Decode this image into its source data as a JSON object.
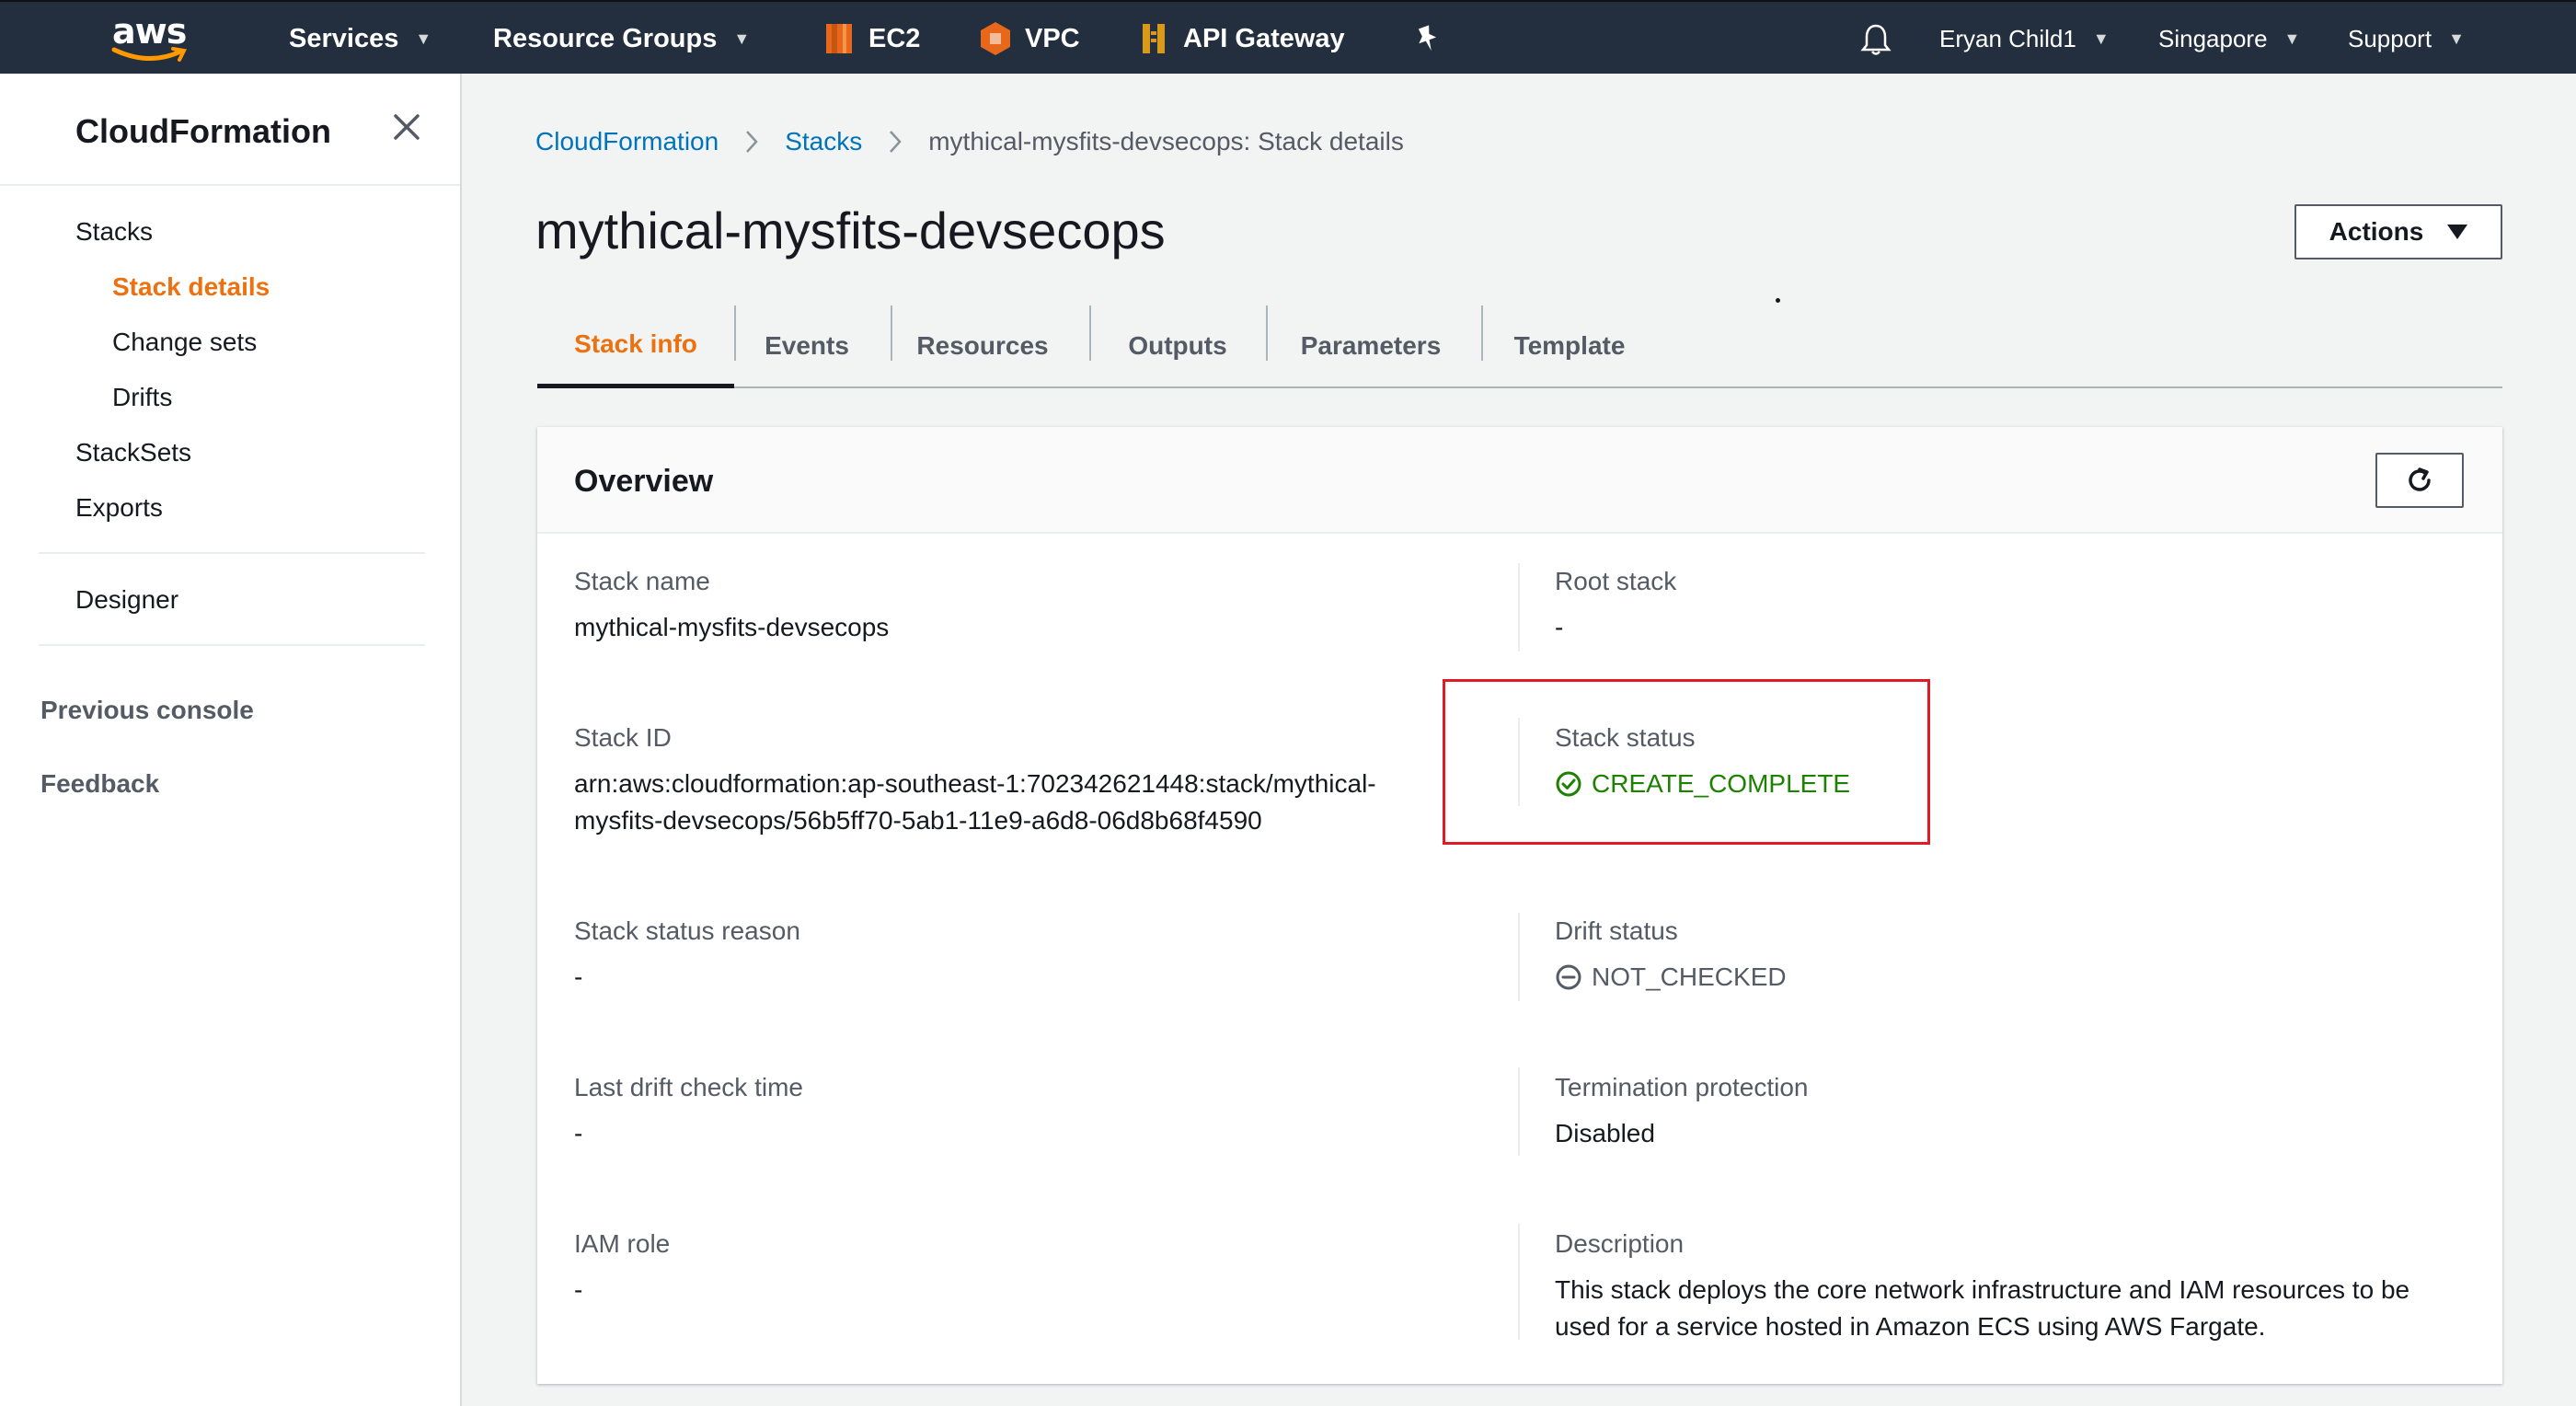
{
  "topnav": {
    "logo_text": "aws",
    "services": "Services",
    "resource_groups": "Resource Groups",
    "shortcuts": [
      {
        "label": "EC2",
        "icon": "ec2-icon",
        "color": "#e7681b"
      },
      {
        "label": "VPC",
        "icon": "vpc-icon",
        "color": "#e7681b"
      },
      {
        "label": "API Gateway",
        "icon": "api-gateway-icon",
        "color": "#d99a1b"
      }
    ],
    "user": "Eryan Child1",
    "region": "Singapore",
    "support": "Support"
  },
  "sidebar": {
    "title": "CloudFormation",
    "stacks": "Stacks",
    "stack_details": "Stack details",
    "change_sets": "Change sets",
    "drifts": "Drifts",
    "stacksets": "StackSets",
    "exports": "Exports",
    "designer": "Designer",
    "previous_console": "Previous console",
    "feedback": "Feedback"
  },
  "breadcrumb": {
    "root": "CloudFormation",
    "stacks": "Stacks",
    "current": "mythical-mysfits-devsecops: Stack details"
  },
  "page": {
    "title": "mythical-mysfits-devsecops",
    "actions": "Actions"
  },
  "tabs": [
    "Stack info",
    "Events",
    "Resources",
    "Outputs",
    "Parameters",
    "Template"
  ],
  "overview": {
    "title": "Overview",
    "stack_name_label": "Stack name",
    "stack_name": "mythical-mysfits-devsecops",
    "root_stack_label": "Root stack",
    "root_stack": "-",
    "stack_id_label": "Stack ID",
    "stack_id_line1": "arn:aws:cloudformation:ap-southeast-1:702342621448:stack/mythical-",
    "stack_id_line2": "mysfits-devsecops/56b5ff70-5ab1-11e9-a6d8-06d8b68f4590",
    "stack_status_label": "Stack status",
    "stack_status": "CREATE_COMPLETE",
    "stack_status_reason_label": "Stack status reason",
    "stack_status_reason": "-",
    "drift_status_label": "Drift status",
    "drift_status": "NOT_CHECKED",
    "last_drift_label": "Last drift check time",
    "last_drift": "-",
    "termination_label": "Termination protection",
    "termination": "Disabled",
    "iam_role_label": "IAM role",
    "iam_role": "-",
    "description_label": "Description",
    "description_line1": "This stack deploys the core network infrastructure and IAM resources to be",
    "description_line2": "used for a service hosted in Amazon ECS using AWS Fargate."
  },
  "colors": {
    "accent": "#ec7211",
    "link": "#0073bb",
    "success": "#1d8102",
    "highlight": "#e01b24"
  }
}
